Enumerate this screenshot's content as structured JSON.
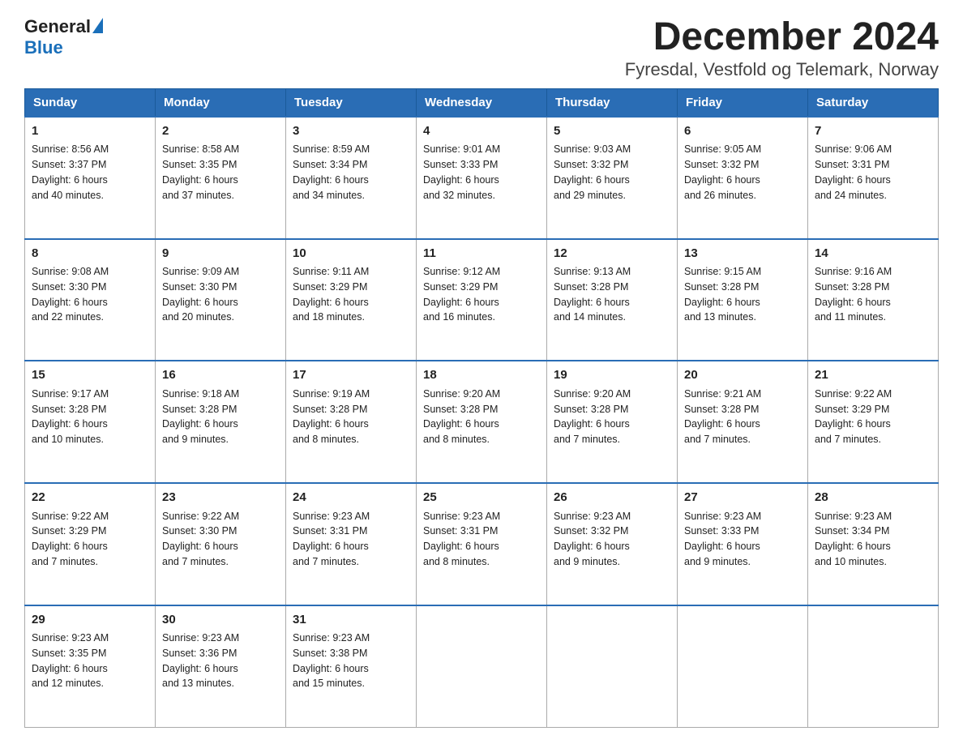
{
  "header": {
    "title": "December 2024",
    "subtitle": "Fyresdal, Vestfold og Telemark, Norway"
  },
  "days_of_week": [
    "Sunday",
    "Monday",
    "Tuesday",
    "Wednesday",
    "Thursday",
    "Friday",
    "Saturday"
  ],
  "weeks": [
    [
      {
        "day": "1",
        "sunrise": "Sunrise: 8:56 AM",
        "sunset": "Sunset: 3:37 PM",
        "daylight": "Daylight: 6 hours",
        "daylight2": "and 40 minutes."
      },
      {
        "day": "2",
        "sunrise": "Sunrise: 8:58 AM",
        "sunset": "Sunset: 3:35 PM",
        "daylight": "Daylight: 6 hours",
        "daylight2": "and 37 minutes."
      },
      {
        "day": "3",
        "sunrise": "Sunrise: 8:59 AM",
        "sunset": "Sunset: 3:34 PM",
        "daylight": "Daylight: 6 hours",
        "daylight2": "and 34 minutes."
      },
      {
        "day": "4",
        "sunrise": "Sunrise: 9:01 AM",
        "sunset": "Sunset: 3:33 PM",
        "daylight": "Daylight: 6 hours",
        "daylight2": "and 32 minutes."
      },
      {
        "day": "5",
        "sunrise": "Sunrise: 9:03 AM",
        "sunset": "Sunset: 3:32 PM",
        "daylight": "Daylight: 6 hours",
        "daylight2": "and 29 minutes."
      },
      {
        "day": "6",
        "sunrise": "Sunrise: 9:05 AM",
        "sunset": "Sunset: 3:32 PM",
        "daylight": "Daylight: 6 hours",
        "daylight2": "and 26 minutes."
      },
      {
        "day": "7",
        "sunrise": "Sunrise: 9:06 AM",
        "sunset": "Sunset: 3:31 PM",
        "daylight": "Daylight: 6 hours",
        "daylight2": "and 24 minutes."
      }
    ],
    [
      {
        "day": "8",
        "sunrise": "Sunrise: 9:08 AM",
        "sunset": "Sunset: 3:30 PM",
        "daylight": "Daylight: 6 hours",
        "daylight2": "and 22 minutes."
      },
      {
        "day": "9",
        "sunrise": "Sunrise: 9:09 AM",
        "sunset": "Sunset: 3:30 PM",
        "daylight": "Daylight: 6 hours",
        "daylight2": "and 20 minutes."
      },
      {
        "day": "10",
        "sunrise": "Sunrise: 9:11 AM",
        "sunset": "Sunset: 3:29 PM",
        "daylight": "Daylight: 6 hours",
        "daylight2": "and 18 minutes."
      },
      {
        "day": "11",
        "sunrise": "Sunrise: 9:12 AM",
        "sunset": "Sunset: 3:29 PM",
        "daylight": "Daylight: 6 hours",
        "daylight2": "and 16 minutes."
      },
      {
        "day": "12",
        "sunrise": "Sunrise: 9:13 AM",
        "sunset": "Sunset: 3:28 PM",
        "daylight": "Daylight: 6 hours",
        "daylight2": "and 14 minutes."
      },
      {
        "day": "13",
        "sunrise": "Sunrise: 9:15 AM",
        "sunset": "Sunset: 3:28 PM",
        "daylight": "Daylight: 6 hours",
        "daylight2": "and 13 minutes."
      },
      {
        "day": "14",
        "sunrise": "Sunrise: 9:16 AM",
        "sunset": "Sunset: 3:28 PM",
        "daylight": "Daylight: 6 hours",
        "daylight2": "and 11 minutes."
      }
    ],
    [
      {
        "day": "15",
        "sunrise": "Sunrise: 9:17 AM",
        "sunset": "Sunset: 3:28 PM",
        "daylight": "Daylight: 6 hours",
        "daylight2": "and 10 minutes."
      },
      {
        "day": "16",
        "sunrise": "Sunrise: 9:18 AM",
        "sunset": "Sunset: 3:28 PM",
        "daylight": "Daylight: 6 hours",
        "daylight2": "and 9 minutes."
      },
      {
        "day": "17",
        "sunrise": "Sunrise: 9:19 AM",
        "sunset": "Sunset: 3:28 PM",
        "daylight": "Daylight: 6 hours",
        "daylight2": "and 8 minutes."
      },
      {
        "day": "18",
        "sunrise": "Sunrise: 9:20 AM",
        "sunset": "Sunset: 3:28 PM",
        "daylight": "Daylight: 6 hours",
        "daylight2": "and 8 minutes."
      },
      {
        "day": "19",
        "sunrise": "Sunrise: 9:20 AM",
        "sunset": "Sunset: 3:28 PM",
        "daylight": "Daylight: 6 hours",
        "daylight2": "and 7 minutes."
      },
      {
        "day": "20",
        "sunrise": "Sunrise: 9:21 AM",
        "sunset": "Sunset: 3:28 PM",
        "daylight": "Daylight: 6 hours",
        "daylight2": "and 7 minutes."
      },
      {
        "day": "21",
        "sunrise": "Sunrise: 9:22 AM",
        "sunset": "Sunset: 3:29 PM",
        "daylight": "Daylight: 6 hours",
        "daylight2": "and 7 minutes."
      }
    ],
    [
      {
        "day": "22",
        "sunrise": "Sunrise: 9:22 AM",
        "sunset": "Sunset: 3:29 PM",
        "daylight": "Daylight: 6 hours",
        "daylight2": "and 7 minutes."
      },
      {
        "day": "23",
        "sunrise": "Sunrise: 9:22 AM",
        "sunset": "Sunset: 3:30 PM",
        "daylight": "Daylight: 6 hours",
        "daylight2": "and 7 minutes."
      },
      {
        "day": "24",
        "sunrise": "Sunrise: 9:23 AM",
        "sunset": "Sunset: 3:31 PM",
        "daylight": "Daylight: 6 hours",
        "daylight2": "and 7 minutes."
      },
      {
        "day": "25",
        "sunrise": "Sunrise: 9:23 AM",
        "sunset": "Sunset: 3:31 PM",
        "daylight": "Daylight: 6 hours",
        "daylight2": "and 8 minutes."
      },
      {
        "day": "26",
        "sunrise": "Sunrise: 9:23 AM",
        "sunset": "Sunset: 3:32 PM",
        "daylight": "Daylight: 6 hours",
        "daylight2": "and 9 minutes."
      },
      {
        "day": "27",
        "sunrise": "Sunrise: 9:23 AM",
        "sunset": "Sunset: 3:33 PM",
        "daylight": "Daylight: 6 hours",
        "daylight2": "and 9 minutes."
      },
      {
        "day": "28",
        "sunrise": "Sunrise: 9:23 AM",
        "sunset": "Sunset: 3:34 PM",
        "daylight": "Daylight: 6 hours",
        "daylight2": "and 10 minutes."
      }
    ],
    [
      {
        "day": "29",
        "sunrise": "Sunrise: 9:23 AM",
        "sunset": "Sunset: 3:35 PM",
        "daylight": "Daylight: 6 hours",
        "daylight2": "and 12 minutes."
      },
      {
        "day": "30",
        "sunrise": "Sunrise: 9:23 AM",
        "sunset": "Sunset: 3:36 PM",
        "daylight": "Daylight: 6 hours",
        "daylight2": "and 13 minutes."
      },
      {
        "day": "31",
        "sunrise": "Sunrise: 9:23 AM",
        "sunset": "Sunset: 3:38 PM",
        "daylight": "Daylight: 6 hours",
        "daylight2": "and 15 minutes."
      },
      null,
      null,
      null,
      null
    ]
  ]
}
